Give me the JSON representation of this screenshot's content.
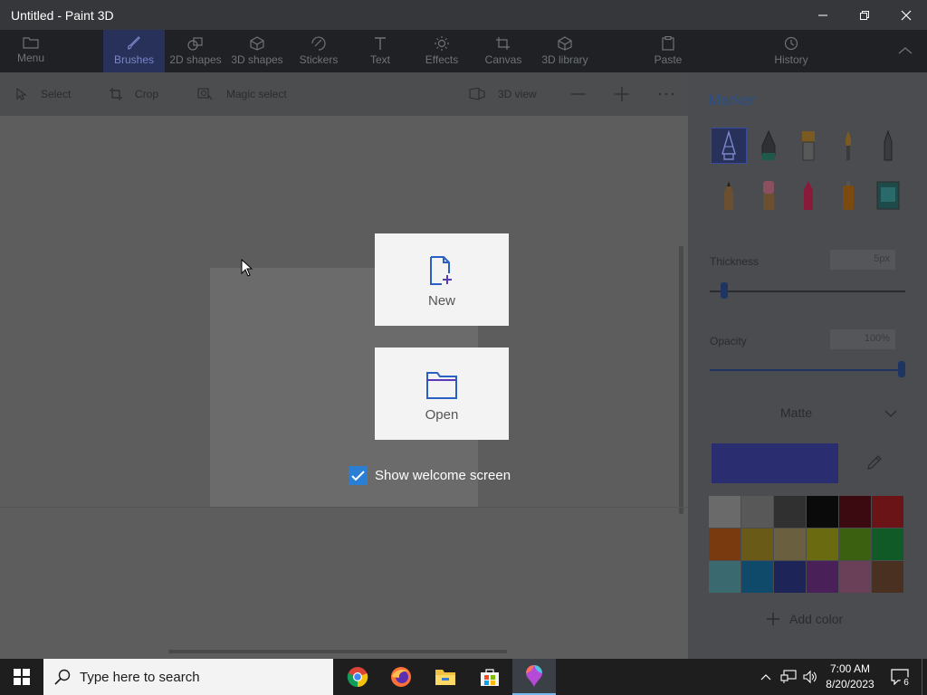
{
  "window": {
    "title": "Untitled - Paint 3D"
  },
  "toolbar": {
    "items": [
      {
        "label": "Menu",
        "icon": "folder-icon"
      },
      {
        "label": "Brushes",
        "icon": "brush-icon"
      },
      {
        "label": "2D shapes",
        "icon": "2d-shapes-icon"
      },
      {
        "label": "3D shapes",
        "icon": "3d-shapes-icon"
      },
      {
        "label": "Stickers",
        "icon": "sticker-icon"
      },
      {
        "label": "Text",
        "icon": "text-icon"
      },
      {
        "label": "Effects",
        "icon": "sun-icon"
      },
      {
        "label": "Canvas",
        "icon": "canvas-icon"
      },
      {
        "label": "3D library",
        "icon": "3d-library-icon"
      },
      {
        "label": "Paste",
        "icon": "clipboard-icon"
      },
      {
        "label": "History",
        "icon": "history-icon"
      }
    ]
  },
  "subbar": {
    "select": "Select",
    "crop": "Crop",
    "magic_select": "Magic select",
    "view_3d": "3D view"
  },
  "panel": {
    "title": "Marker",
    "thickness_label": "Thickness",
    "thickness_value": "5px",
    "thickness_fraction": 0.06,
    "opacity_label": "Opacity",
    "opacity_value": "100%",
    "opacity_fraction": 1.0,
    "finish": "Matte",
    "current_color": "#2a2d70",
    "add_color": "Add color",
    "palette": [
      "#6a6a6a",
      "#585858",
      "#303030",
      "#0a0a0a",
      "#3a0a10",
      "#6a1418",
      "#7a3a10",
      "#6a5a18",
      "#6a6040",
      "#6a6a10",
      "#3a6010",
      "#105a28",
      "#3a6a70",
      "#104a6a",
      "#1c2458",
      "#4a2058",
      "#6a4058",
      "#4a3020"
    ]
  },
  "welcome": {
    "new_label": "New",
    "open_label": "Open",
    "show_welcome": "Show welcome screen"
  },
  "taskbar": {
    "search_placeholder": "Type here to search",
    "time": "7:00 AM",
    "date": "8/20/2023",
    "notifications": "6"
  }
}
